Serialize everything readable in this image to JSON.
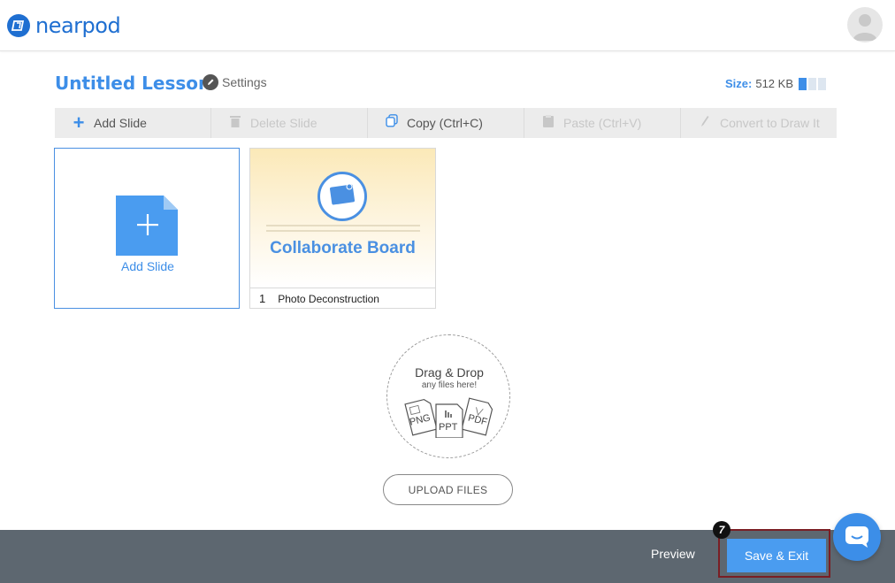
{
  "app": {
    "brand": "nearpod",
    "brand_color": "#1f6fd1",
    "accent": "#3d8ee8"
  },
  "header": {
    "avatar_icon": "user-avatar-icon"
  },
  "lesson": {
    "title": "Untitled Lesson",
    "settings_label": "Settings",
    "size_label": "Size:",
    "size_value": "512 KB",
    "size_meter_fraction": 0.33
  },
  "toolbar": {
    "items": [
      {
        "label": "Add Slide",
        "icon": "plus-icon",
        "enabled": true
      },
      {
        "label": "Delete Slide",
        "icon": "trash-icon",
        "enabled": false
      },
      {
        "label": "Copy (Ctrl+C)",
        "icon": "copy-icon",
        "enabled": true
      },
      {
        "label": "Paste (Ctrl+V)",
        "icon": "paste-icon",
        "enabled": false
      },
      {
        "label": "Convert to Draw It",
        "icon": "pencil-icon",
        "enabled": false
      }
    ]
  },
  "add_slide_card": {
    "label": "Add Slide"
  },
  "slides": [
    {
      "number": "1",
      "name": "Photo Deconstruction",
      "thumb_title": "Collaborate Board"
    }
  ],
  "drop_zone": {
    "title": "Drag & Drop",
    "subtitle": "any files here!",
    "file_types": [
      "PNG",
      "PPT",
      "PDF"
    ]
  },
  "upload_button": "UPLOAD FILES",
  "footer": {
    "preview_label": "Preview",
    "save_label": "Save & Exit",
    "step_badge": "7"
  }
}
